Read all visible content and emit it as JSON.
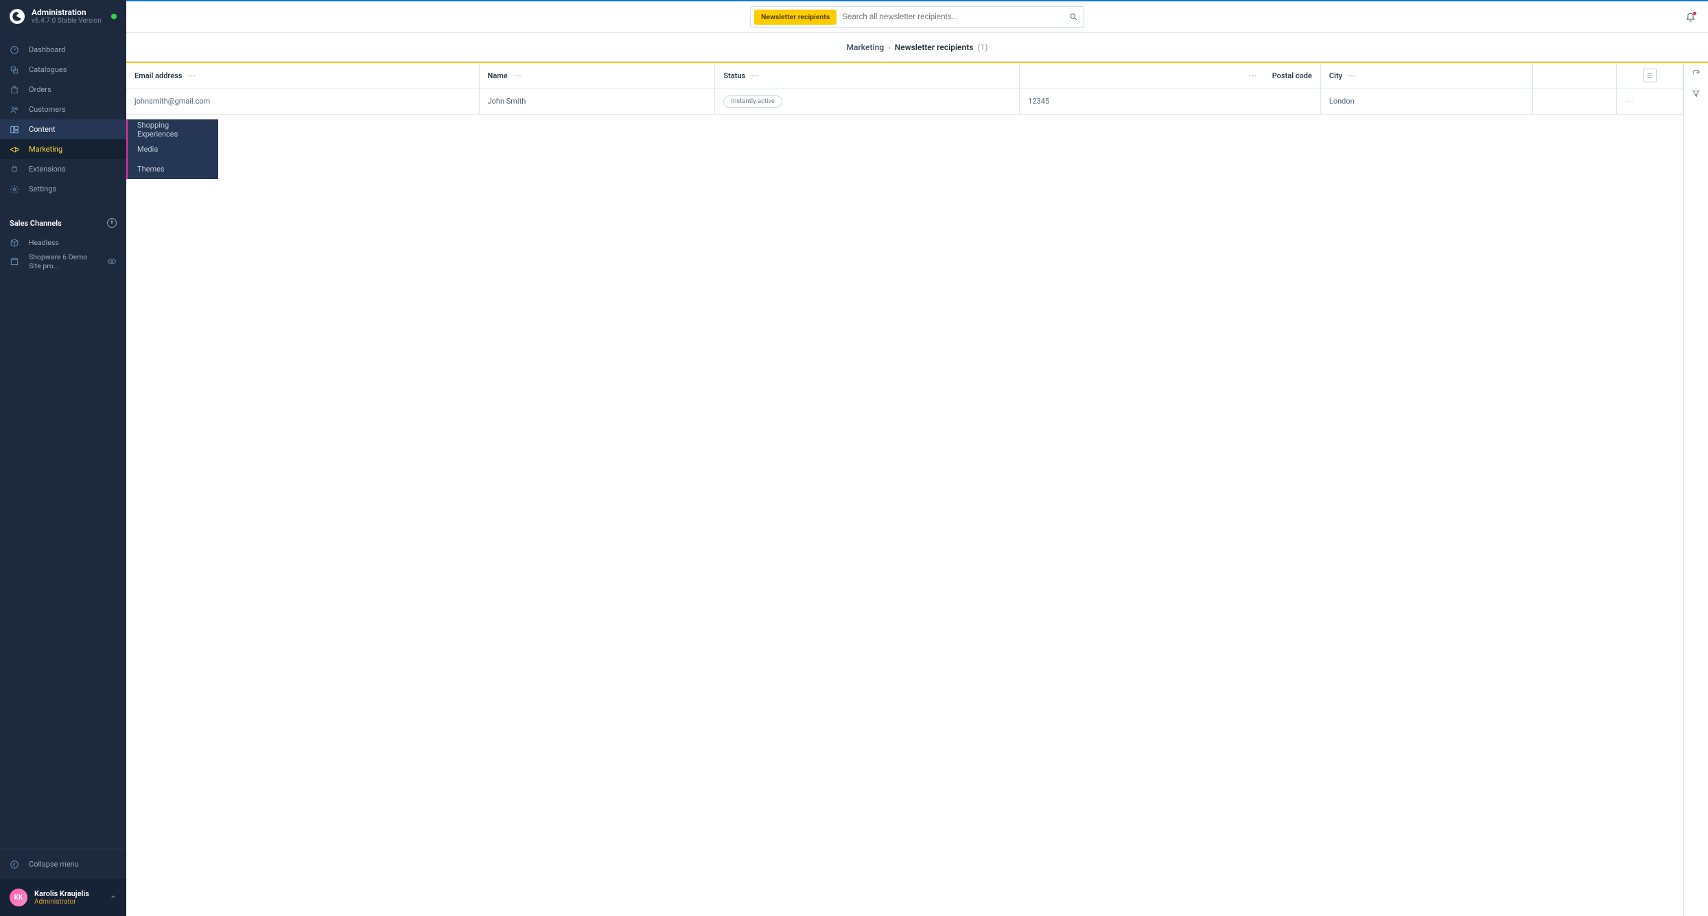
{
  "app": {
    "title": "Administration",
    "version": "v6.4.7.0 Stable Version"
  },
  "nav": {
    "items": [
      {
        "label": "Dashboard"
      },
      {
        "label": "Catalogues"
      },
      {
        "label": "Orders"
      },
      {
        "label": "Customers"
      },
      {
        "label": "Content"
      },
      {
        "label": "Marketing"
      },
      {
        "label": "Extensions"
      },
      {
        "label": "Settings"
      }
    ]
  },
  "flyout": {
    "items": [
      {
        "label": "Shopping Experiences"
      },
      {
        "label": "Media"
      },
      {
        "label": "Themes"
      }
    ]
  },
  "sales_channels": {
    "heading": "Sales Channels",
    "items": [
      {
        "label": "Headless"
      },
      {
        "label": "Shopware 6 Demo Site pro..."
      }
    ]
  },
  "collapse_label": "Collapse menu",
  "user": {
    "initials": "KK",
    "name": "Karolis Kraujelis",
    "role": "Administrator"
  },
  "search": {
    "tag": "Newsletter recipients",
    "placeholder": "Search all newsletter recipients..."
  },
  "breadcrumb": {
    "root": "Marketing",
    "page": "Newsletter recipients",
    "count": "(1)"
  },
  "table": {
    "columns": {
      "email": "Email address",
      "name": "Name",
      "status": "Status",
      "postal": "Postal code",
      "city": "City"
    },
    "rows": [
      {
        "email": "johnsmith@gmail.com",
        "name": "John Smith",
        "status": "Instantly active",
        "postal": "12345",
        "city": "London"
      }
    ]
  }
}
